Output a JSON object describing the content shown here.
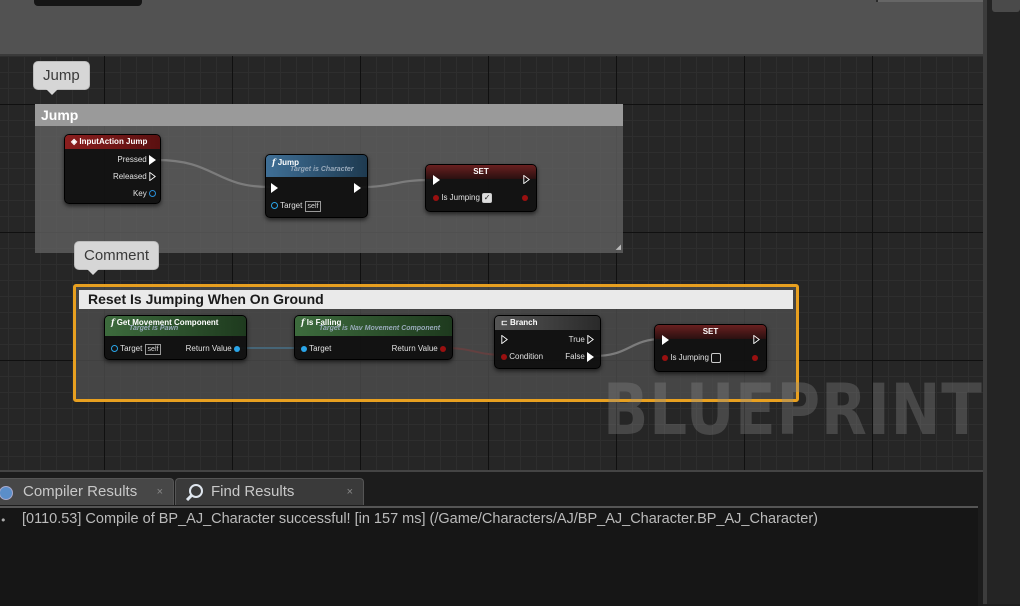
{
  "graph": {
    "jump_bubble": "Jump",
    "jump_comment_title": "Jump",
    "comment_bubble": "Comment",
    "reset_comment_title": "Reset Is Jumping When On Ground",
    "watermark": "BLUEPRINT",
    "nodes": {
      "input_action": {
        "title": "InputAction Jump",
        "pins": [
          "Pressed",
          "Released",
          "Key"
        ]
      },
      "jump": {
        "title": "Jump",
        "subtitle": "Target is Character",
        "target_label": "Target",
        "target_value": "self"
      },
      "set1": {
        "title": "SET",
        "var_label": "Is Jumping",
        "checked": true
      },
      "get_movement": {
        "title": "Get Movement Component",
        "subtitle": "Target is Pawn",
        "target_label": "Target",
        "target_value": "self",
        "return_label": "Return Value"
      },
      "is_falling": {
        "title": "Is Falling",
        "subtitle": "Target is Nav Movement Component",
        "target_label": "Target",
        "return_label": "Return Value"
      },
      "branch": {
        "title": "Branch",
        "condition_label": "Condition",
        "true_label": "True",
        "false_label": "False"
      },
      "set2": {
        "title": "SET",
        "var_label": "Is Jumping",
        "checked": false
      }
    }
  },
  "bottom_panel": {
    "tabs": [
      {
        "label": "Compiler Results",
        "close": "×"
      },
      {
        "label": "Find Results",
        "close": "×"
      }
    ],
    "log": "[0110.53] Compile of BP_AJ_Character successful! [in 157 ms] (/Game/Characters/AJ/BP_AJ_Character.BP_AJ_Character)"
  },
  "colors": {
    "input_header": "#8b1e1e",
    "function_header": "#3f6f96",
    "pure_header": "#3d6b3d",
    "set_header": "#5a1e1e",
    "object_pin": "#2aa5e8",
    "bool_pin": "#9a1010",
    "selected_comment_border": "#e8a020"
  }
}
